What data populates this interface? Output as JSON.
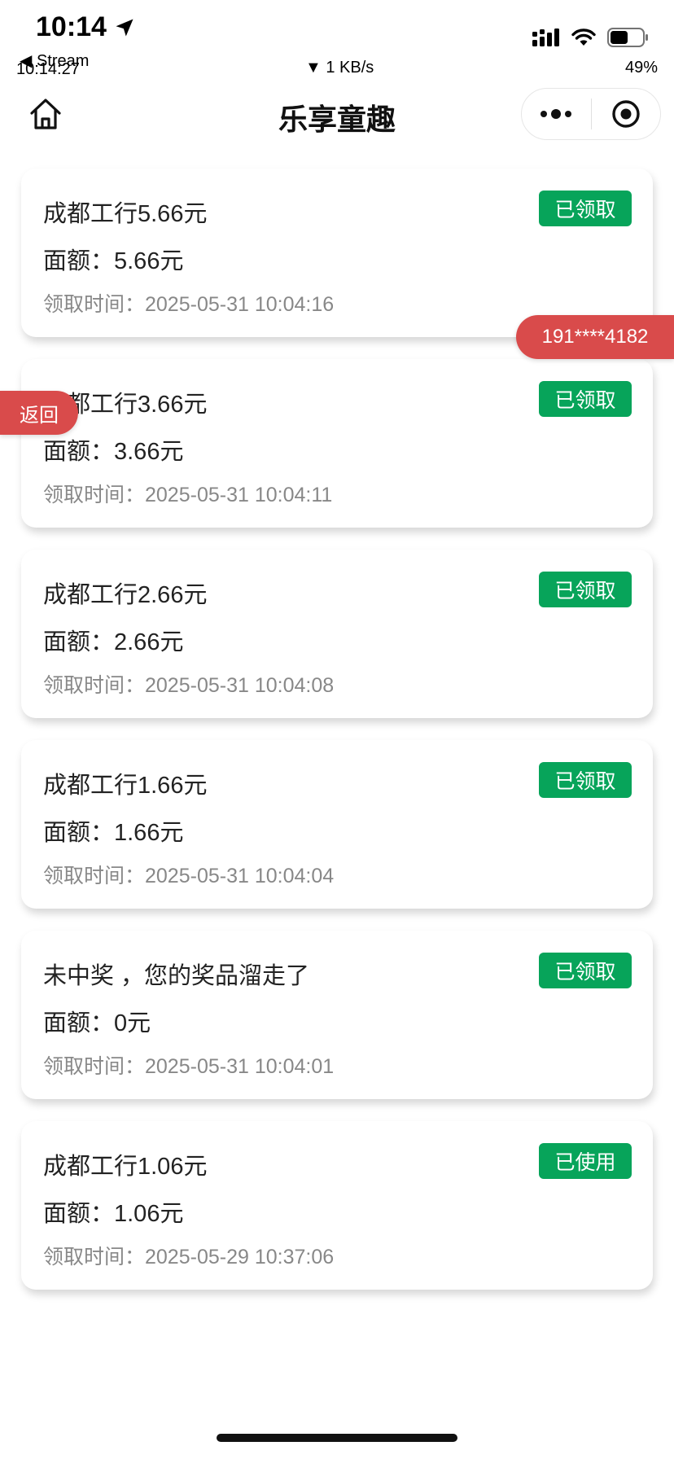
{
  "status_bar": {
    "time": "10:14",
    "back_app": "◀ Stream",
    "clock_small": "10:14:27",
    "network_speed": "▼ 1 KB/s",
    "battery": "49%",
    "icons": [
      "location-arrow-icon",
      "signal-icon",
      "wifi-icon",
      "battery-icon"
    ]
  },
  "navbar": {
    "title": "乐享童趣",
    "icons": [
      "home-icon",
      "more-icon",
      "close-target-icon"
    ]
  },
  "records": [
    {
      "title": "成都工行5.66元",
      "amount": "面额：5.66元",
      "time": "领取时间：2025-05-31 10:04:16",
      "status": "已领取"
    },
    {
      "title": "成都工行3.66元",
      "amount": "面额：3.66元",
      "time": "领取时间：2025-05-31 10:04:11",
      "status": "已领取"
    },
    {
      "title": "成都工行2.66元",
      "amount": "面额：2.66元",
      "time": "领取时间：2025-05-31 10:04:08",
      "status": "已领取"
    },
    {
      "title": "成都工行1.66元",
      "amount": "面额：1.66元",
      "time": "领取时间：2025-05-31 10:04:04",
      "status": "已领取"
    },
    {
      "title": "未中奖 ，您的奖品溜走了",
      "amount": "面额：0元",
      "time": "领取时间：2025-05-31 10:04:01",
      "status": "已领取"
    },
    {
      "title": "成都工行1.06元",
      "amount": "面额：1.06元",
      "time": "领取时间：2025-05-29 10:37:06",
      "status": "已使用"
    }
  ],
  "floating": {
    "phone": "191****4182",
    "back": "返回"
  },
  "colors": {
    "badge_green": "#07a45a",
    "tag_red": "#d94b4b"
  }
}
